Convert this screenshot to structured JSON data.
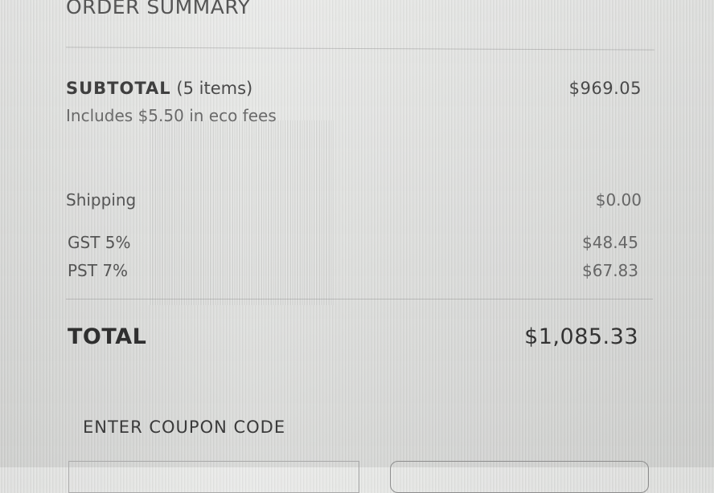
{
  "order_summary": {
    "title": "ORDER SUMMARY",
    "subtotal": {
      "label": "SUBTOTAL",
      "item_count": "(5 items)",
      "value": "$969.05",
      "eco_fees_note": "Includes $5.50 in eco fees"
    },
    "shipping": {
      "label": "Shipping",
      "value": "$0.00"
    },
    "gst": {
      "label": "GST 5%",
      "value": "$48.45"
    },
    "pst": {
      "label": "PST 7%",
      "value": "$67.83"
    },
    "total": {
      "label": "TOTAL",
      "value": "$1,085.33"
    }
  },
  "coupon": {
    "link_label": "ENTER COUPON CODE",
    "input_value": ""
  }
}
